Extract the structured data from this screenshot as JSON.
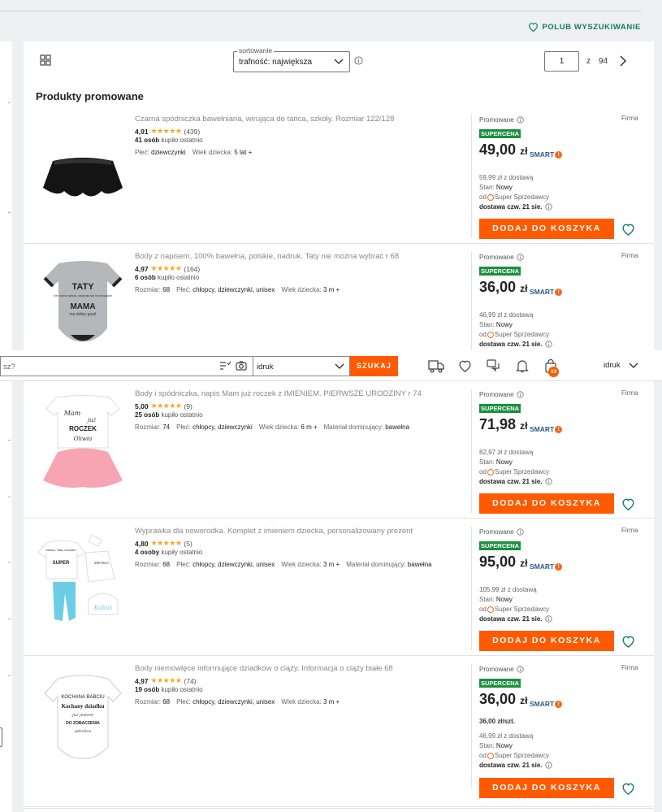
{
  "header": {
    "like_search_label": "POLUB WYSZUKIWANIE"
  },
  "toolbar": {
    "sort_legend": "sortowanie",
    "sort_value": "trafność: największa",
    "page_current": "1",
    "page_of": "z",
    "page_total": "94"
  },
  "section_title": "Produkty promowane",
  "sticky": {
    "search_placeholder": "sz?",
    "category_value": "idruk",
    "search_button": "SZUKAJ",
    "cart_count": "33",
    "user_label": "idruk"
  },
  "products": [
    {
      "title": "Czarna spódniczka bawełniana, wirująca do tańca, szkoły. Rozmiar 122/128",
      "rating": "4,91",
      "stars": "★★★★★",
      "reviews": "(439)",
      "bought_num": "41 osób",
      "bought_text": "kupiło ostatnio",
      "params": [
        {
          "label": "Płeć:",
          "value": "dziewczynki"
        },
        {
          "label": "Wiek dziecka:",
          "value": "5 lat +"
        }
      ],
      "promo": "Promowane",
      "firma": "Firma",
      "badge": "SUPERCENA",
      "price_main": "49,00",
      "price_cur": "zł",
      "smart": "SMART",
      "unit": "",
      "delivered": "59,99 zł z dostawą",
      "cond_label": "Stan:",
      "cond_value": "Nowy",
      "seller_prefix": "od",
      "seller": "Super Sprzedawcy",
      "delivery": "dostawa czw. 21 sie.",
      "cart": "DODAJ DO KOSZYKA"
    },
    {
      "title": "Body z napisem, 100% bawełna, polskie, nadruk. Taty nie można wybrać r 68",
      "rating": "4,97",
      "stars": "★★★★★",
      "reviews": "(164)",
      "bought_num": "6 osób",
      "bought_text": "kupiło ostatnio",
      "params": [
        {
          "label": "Rozmiar:",
          "value": "68"
        },
        {
          "label": "Płeć:",
          "value": "chłopcy, dziewczynki, unisex"
        },
        {
          "label": "Wiek dziecka:",
          "value": "3 m +"
        }
      ],
      "promo": "Promowane",
      "firma": "Firma",
      "badge": "SUPERCENA",
      "price_main": "36,00",
      "price_cur": "zł",
      "smart": "SMART",
      "unit": "",
      "delivered": "46,99 zł z dostawą",
      "cond_label": "Stan:",
      "cond_value": "Nowy",
      "seller_prefix": "od",
      "seller": "Super Sprzedawcy",
      "delivery": "dostawa czw. 21 sie.",
      "cart": "DODAJ DO KOSZYKA"
    },
    {
      "title": "Body i spódniczka, napis Mam już roczek z IMIENIEM. PIERWSZE URODZINY r 74",
      "rating": "5,00",
      "stars": "★★★★★",
      "reviews": "(9)",
      "bought_num": "25 osób",
      "bought_text": "kupiło ostatnio",
      "params": [
        {
          "label": "Rozmiar:",
          "value": "74"
        },
        {
          "label": "Płeć:",
          "value": "chłopcy, dziewczynki"
        },
        {
          "label": "Wiek dziecka:",
          "value": "6 m +"
        },
        {
          "label": "Materiał dominujący:",
          "value": "bawełna"
        }
      ],
      "promo": "Promowane",
      "firma": "Firma",
      "badge": "SUPERCENA",
      "price_main": "71,98",
      "price_cur": "zł",
      "smart": "SMART",
      "unit": "",
      "delivered": "82,97 zł z dostawą",
      "cond_label": "Stan:",
      "cond_value": "Nowy",
      "seller_prefix": "od",
      "seller": "Super Sprzedawcy",
      "delivery": "dostawa czw. 21 sie.",
      "cart": "DODAJ DO KOSZYKA"
    },
    {
      "title": "Wyprawka dla noworodka. Komplet z imieniem dziecka, personalizowany prezent",
      "rating": "4,80",
      "stars": "★★★★★",
      "reviews": "(5)",
      "bought_num": "4 osoby",
      "bought_text": "kupiły ostatnio",
      "params": [
        {
          "label": "Rozmiar:",
          "value": "68"
        },
        {
          "label": "Płeć:",
          "value": "chłopcy, dziewczynki, unisex"
        },
        {
          "label": "Wiek dziecka:",
          "value": "3 m +"
        },
        {
          "label": "Materiał dominujący:",
          "value": "bawełna"
        }
      ],
      "promo": "Promowane",
      "firma": "Firma",
      "badge": "SUPERCENA",
      "price_main": "95,00",
      "price_cur": "zł",
      "smart": "SMART",
      "unit": "",
      "delivered": "105,99 zł z dostawą",
      "cond_label": "Stan:",
      "cond_value": "Nowy",
      "seller_prefix": "od",
      "seller": "Super Sprzedawcy",
      "delivery": "dostawa czw. 21 sie.",
      "cart": "DODAJ DO KOSZYKA"
    },
    {
      "title": "Body niemowlęce informujące dziadków o ciąży. Informacja o ciąży białe 68",
      "rating": "4,97",
      "stars": "★★★★★",
      "reviews": "(74)",
      "bought_num": "19 osób",
      "bought_text": "kupiło ostatnio",
      "params": [
        {
          "label": "Rozmiar:",
          "value": "68"
        },
        {
          "label": "Płeć:",
          "value": "chłopcy, dziewczynki, unisex"
        },
        {
          "label": "Wiek dziecka:",
          "value": "3 m +"
        }
      ],
      "promo": "Promowane",
      "firma": "Firma",
      "badge": "SUPERCENA",
      "price_main": "36,00",
      "price_cur": "zł",
      "smart": "SMART",
      "unit": "36,00 zł/szt.",
      "delivered": "46,99 zł z dostawą",
      "cond_label": "Stan:",
      "cond_value": "Nowy",
      "seller_prefix": "od",
      "seller": "Super Sprzedawcy",
      "delivery": "dostawa czw. 21 sie.",
      "cart": "DODAJ DO KOSZYKA"
    }
  ],
  "image_texts": {
    "p2": [
      "TATY",
      "nie można wybrać, wszystko się ma szczęście",
      "MAMA",
      "ma dobry gust!"
    ],
    "p3": [
      "Mam",
      "już",
      "ROCZEK",
      "Oliwia"
    ],
    "p4": [
      "Mama, Tata, kocham",
      "SUPER",
      "Kubuś",
      "ZMYSŁA"
    ],
    "p5": [
      "KOCHANA BABCIU",
      "Kochany dziadku",
      "już jestem",
      "DO ZOBACZENIA",
      "wkrótce"
    ]
  },
  "colors": {
    "accent": "#ff5a00",
    "green": "#1a8f3e",
    "teal": "#0f7b6c",
    "star": "#f5a623"
  }
}
